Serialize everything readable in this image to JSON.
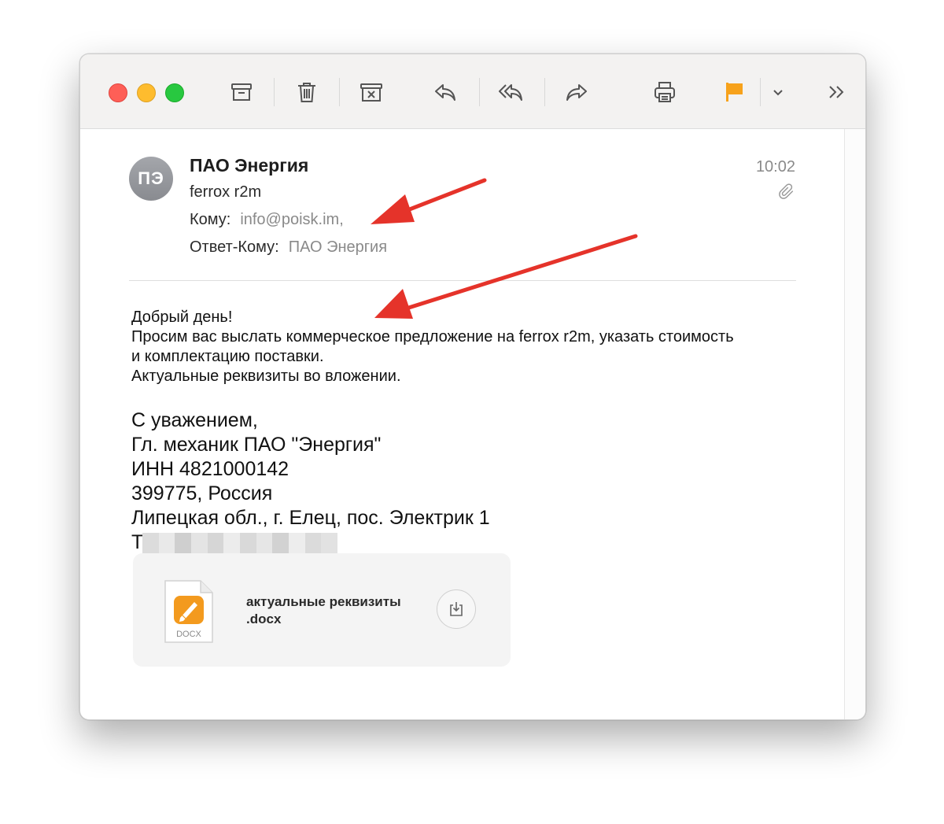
{
  "toolbar": {
    "items": [
      {
        "name": "archive-icon"
      },
      {
        "name": "trash-icon"
      },
      {
        "name": "junk-icon"
      },
      {
        "name": "reply-icon"
      },
      {
        "name": "reply-all-icon"
      },
      {
        "name": "forward-icon"
      },
      {
        "name": "print-icon"
      },
      {
        "name": "flag-icon",
        "color": "#f7a21b"
      },
      {
        "name": "chevron-down-icon"
      },
      {
        "name": "more-chevrons-icon"
      }
    ]
  },
  "message": {
    "avatar_initials": "ПЭ",
    "sender": "ПАО Энергия",
    "subject": "ferrox r2m",
    "to_label": "Кому:",
    "to_value": "info@poisk.im,",
    "reply_to_label": "Ответ-Кому:",
    "reply_to_value": "ПАО Энергия",
    "time": "10:02"
  },
  "body": {
    "lines_small": [
      "Добрый день!",
      "Просим вас выслать коммерческое предложение на ferrox r2m, указать стоимость",
      "и комплектацию поставки.",
      "Актуальные реквизиты во вложении."
    ],
    "lines_large": [
      "С уважением,",
      "Гл. механик ПАО \"Энергия\"",
      "ИНН 4821000142",
      "399775, Россия",
      "Липецкая обл., г. Елец, пос. Электрик 1"
    ],
    "phone_prefix": "Т"
  },
  "attachment": {
    "name_line1": "актуальные реквизиты",
    "name_line2": ".docx",
    "icon_label": "DOCX"
  },
  "colors": {
    "annotation_arrow": "#e5332a",
    "flag": "#f7a21b",
    "docx_icon": "#f39a1e"
  }
}
